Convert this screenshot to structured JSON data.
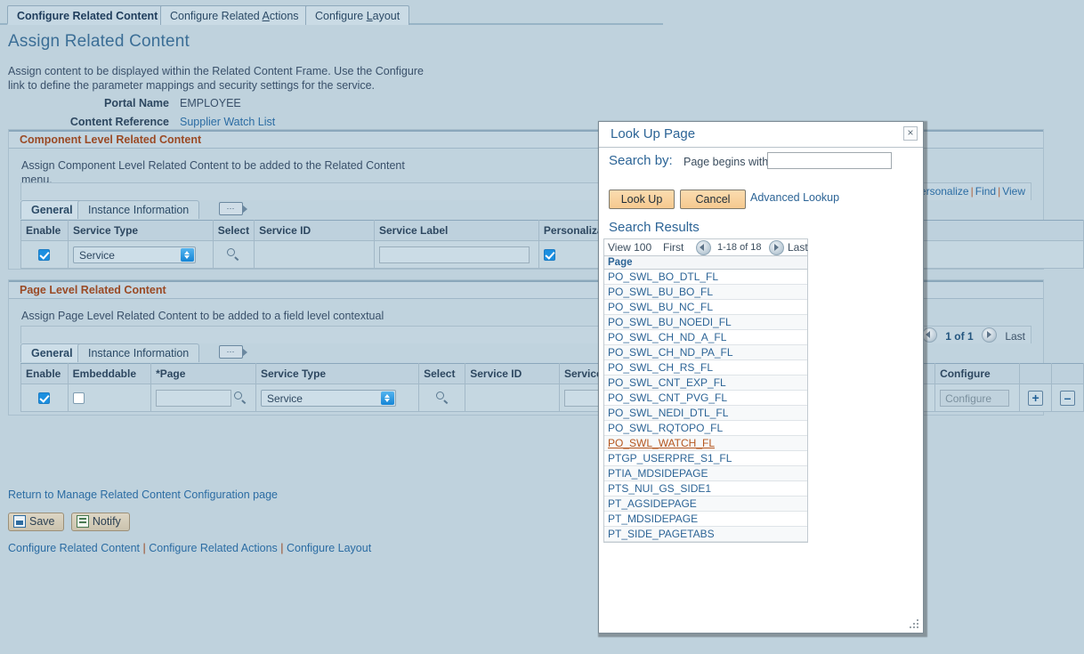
{
  "tabs": [
    {
      "label": "Configure Related Content",
      "active": true
    },
    {
      "label": "Configure Related Actions",
      "active": false,
      "accel": "A"
    },
    {
      "label": "Configure Layout",
      "active": false,
      "accel": "L"
    }
  ],
  "page": {
    "title": "Assign Related Content",
    "intro": "Assign content to be displayed within the Related Content Frame. Use the Configure link to define the parameter mappings and security settings for the service.",
    "fields": [
      {
        "label": "Portal Name",
        "value": "EMPLOYEE",
        "is_link": false
      },
      {
        "label": "Content Reference",
        "value": "Supplier Watch List",
        "is_link": true
      }
    ]
  },
  "component_section": {
    "header": "Component Level Related Content",
    "description": "Assign Component Level Related Content to be added to the Related Content menu.",
    "toolbar_links": [
      "Personalize",
      "Find",
      "View"
    ],
    "subtabs": [
      {
        "label": "General",
        "active": true
      },
      {
        "label": "Instance Information",
        "active": false
      }
    ],
    "grid_icon": "grid-expand-icon",
    "columns": [
      "Enable",
      "Service Type",
      "Select",
      "Service ID",
      "Service Label",
      "Personalization Flag"
    ],
    "rows": [
      {
        "enable": true,
        "service_type": "Service",
        "select_icon": "magnifier-icon",
        "service_id": "",
        "service_label": "",
        "personalization_flag": true
      }
    ]
  },
  "page_section": {
    "header": "Page Level Related Content",
    "description": "Assign Page Level Related Content to be added to a field level contextual menu.",
    "pager": {
      "current": "1 of 1",
      "last_label": "Last"
    },
    "subtabs": [
      {
        "label": "General",
        "active": true
      },
      {
        "label": "Instance Information",
        "active": false
      }
    ],
    "grid_icon": "grid-expand-icon",
    "columns": [
      "Enable",
      "Embeddable",
      "*Page",
      "Service Type",
      "Select",
      "Service ID",
      "Service Label",
      "Configure"
    ],
    "rows": [
      {
        "enable": true,
        "embeddable": false,
        "page": "",
        "service_type": "Service",
        "select_icon": "magnifier-icon",
        "service_id": "",
        "service_label": "",
        "configure_button": "Configure",
        "add_row": "+",
        "delete_row": "–"
      }
    ]
  },
  "footer": {
    "return_link": "Return to Manage Related Content Configuration page",
    "save_label": "Save",
    "notify_label": "Notify",
    "links": [
      "Configure Related Content",
      "Configure Related Actions",
      "Configure Layout"
    ],
    "separator": "|"
  },
  "modal": {
    "title": "Look Up Page",
    "close_label": "×",
    "search_by_label": "Search by:",
    "criteria_label": "Page begins with",
    "criteria_value": "",
    "criteria_placeholder": "",
    "lookup_button": "Look Up",
    "cancel_button": "Cancel",
    "advanced_link": "Advanced Lookup",
    "results_heading": "Search Results",
    "view_label": "View 100",
    "first_label": "First",
    "range_label": "1-18 of 18",
    "last_label": "Last",
    "results_column": "Page",
    "results": [
      {
        "name": "PO_SWL_BO_DTL_FL",
        "hover": false
      },
      {
        "name": "PO_SWL_BU_BO_FL",
        "hover": false
      },
      {
        "name": "PO_SWL_BU_NC_FL",
        "hover": false
      },
      {
        "name": "PO_SWL_BU_NOEDI_FL",
        "hover": false
      },
      {
        "name": "PO_SWL_CH_ND_A_FL",
        "hover": false
      },
      {
        "name": "PO_SWL_CH_ND_PA_FL",
        "hover": false
      },
      {
        "name": "PO_SWL_CH_RS_FL",
        "hover": false
      },
      {
        "name": "PO_SWL_CNT_EXP_FL",
        "hover": false
      },
      {
        "name": "PO_SWL_CNT_PVG_FL",
        "hover": false
      },
      {
        "name": "PO_SWL_NEDI_DTL_FL",
        "hover": false
      },
      {
        "name": "PO_SWL_RQTOPO_FL",
        "hover": false
      },
      {
        "name": "PO_SWL_WATCH_FL",
        "hover": true
      },
      {
        "name": "PTGP_USERPRE_S1_FL",
        "hover": false
      },
      {
        "name": "PTIA_MDSIDEPAGE",
        "hover": false
      },
      {
        "name": "PTS_NUI_GS_SIDE1",
        "hover": false
      },
      {
        "name": "PT_AGSIDEPAGE",
        "hover": false
      },
      {
        "name": "PT_MDSIDEPAGE",
        "hover": false
      },
      {
        "name": "PT_SIDE_PAGETABS",
        "hover": false
      }
    ]
  },
  "colors": {
    "page_background": "#bfd2dd",
    "section_header_text": "#9a4a25",
    "link": "#2b6ca3",
    "title": "#3b6e96",
    "hover_link": "#b5561e",
    "button_orange": "#f5c98f",
    "checkbox_blue": "#1b8fe0"
  }
}
